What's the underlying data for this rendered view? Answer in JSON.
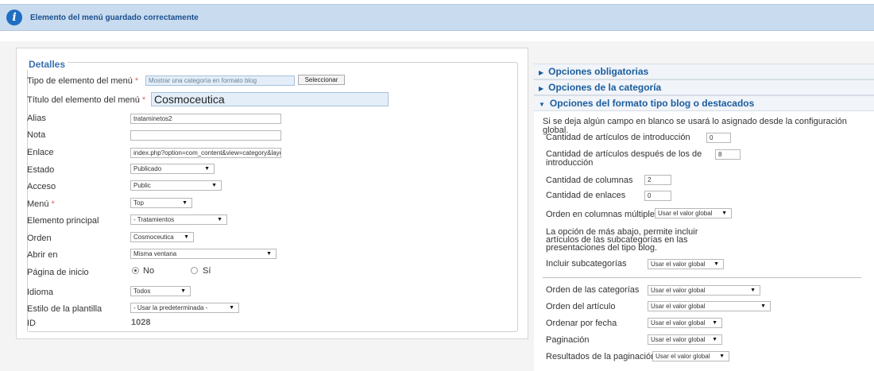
{
  "message": "Elemento del menú guardado correctamente",
  "details": {
    "legend": "Detalles",
    "tipo_label": "Tipo de elemento del menú",
    "tipo_value": "Mostrar una categoría en formato blog",
    "select_button": "Seleccionar",
    "titulo_label": "Título del elemento del menú",
    "titulo_value": "Cosmoceutica",
    "alias_label": "Alias",
    "alias_value": "trataminetos2",
    "nota_label": "Nota",
    "nota_value": "",
    "enlace_label": "Enlace",
    "enlace_value": "index.php?option=com_content&view=category&layout=blo",
    "estado_label": "Estado",
    "estado_value": "Publicado",
    "acceso_label": "Acceso",
    "acceso_value": "Public",
    "menu_label": "Menú",
    "menu_value": "Top",
    "principal_label": "Elemento principal",
    "principal_value": "- Tratamientos",
    "orden_label": "Orden",
    "orden_value": "Cosmoceutica",
    "abrir_label": "Abrir en",
    "abrir_value": "Misma ventana",
    "inicio_label": "Página de inicio",
    "inicio_no": "No",
    "inicio_si": "Sí",
    "idioma_label": "Idioma",
    "idioma_value": "Todos",
    "estilo_label": "Estilo de la plantilla",
    "estilo_value": "- Usar la predeterminada -",
    "id_label": "ID",
    "id_value": "1028",
    "required_mark": "*"
  },
  "accordion": {
    "obligatorias": "Opciones obligatorias",
    "categoria": "Opciones de la categoría",
    "blog": "Opciones del formato tipo blog o destacados"
  },
  "blog": {
    "hint": "Si se deja algún campo en blanco se usará lo asignado desde la configuración global.",
    "intro_label": "Cantidad de artículos de introducción",
    "intro_value": "0",
    "after_label_1": "Cantidad de artículos después de los de",
    "after_label_2": "introducción",
    "after_value": "8",
    "cols_label": "Cantidad de columnas",
    "cols_value": "2",
    "links_label": "Cantidad de enlaces",
    "links_value": "0",
    "multicol_label": "Orden en columnas múltiples",
    "multicol_value": "Usar el valor global",
    "note_1": "La opción de más abajo, permite incluir",
    "note_2": "artículos de las subcategorías en las",
    "note_3": "presentaciones del tipo blog.",
    "subcat_label": "Incluir subcategorías",
    "subcat_value": "Usar el valor global",
    "catorder_label": "Orden de las categorías",
    "catorder_value": "Usar el valor global",
    "artorder_label": "Orden del artículo",
    "artorder_value": "Usar el valor global",
    "date_label": "Ordenar por fecha",
    "date_value": "Usar el valor global",
    "pag_label": "Paginación",
    "pag_value": "Usar el valor global",
    "pagres_label": "Resultados de la paginación",
    "pagres_value": "Usar el valor global"
  },
  "icons": {
    "info": "i",
    "dropdown": "▼",
    "collapsed": "▶",
    "expanded": "▼"
  },
  "colors": {
    "accent": "#1a5d9f",
    "message_bg": "#c9dbee",
    "required": "#e06666"
  }
}
